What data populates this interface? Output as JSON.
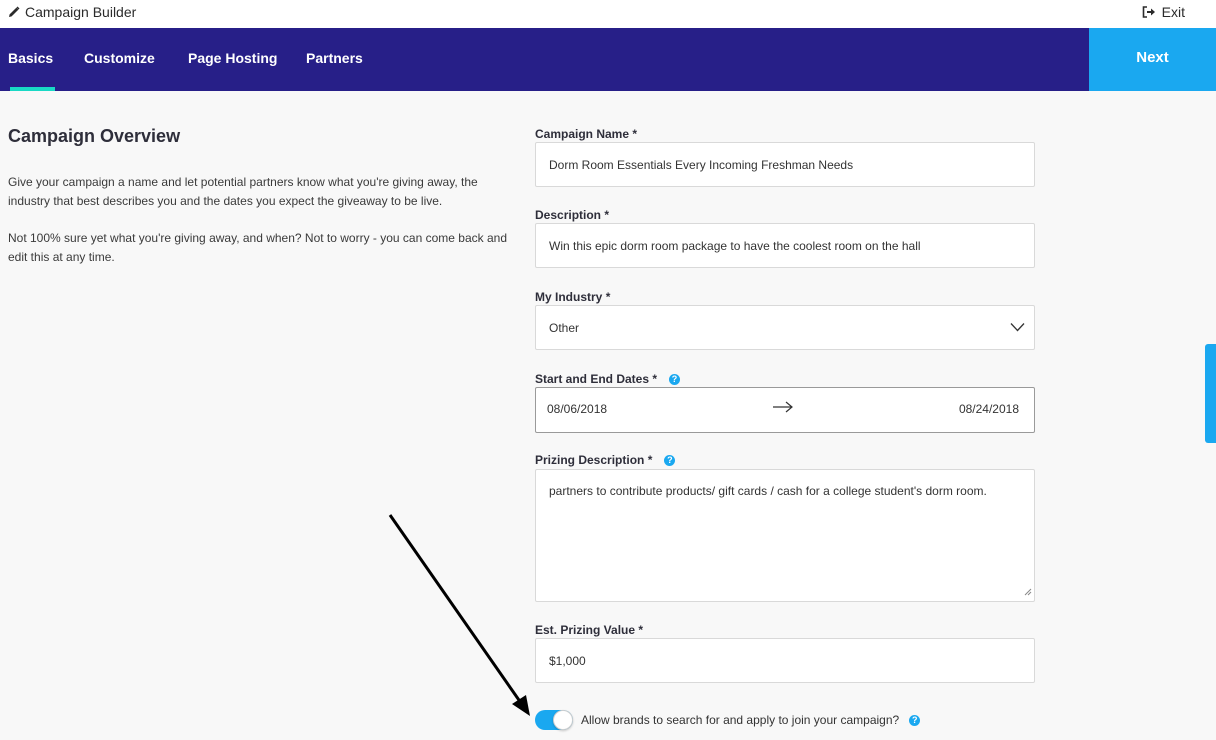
{
  "header": {
    "title": "Campaign Builder",
    "exit_label": "Exit"
  },
  "nav": {
    "tabs": [
      {
        "label": "Basics"
      },
      {
        "label": "Customize"
      },
      {
        "label": "Page Hosting"
      },
      {
        "label": "Partners"
      }
    ],
    "active_tab": "Basics",
    "next_label": "Next"
  },
  "overview": {
    "title": "Campaign Overview",
    "paragraph1_line1": "Give your campaign a name and let potential partners know what you're giving away, the",
    "paragraph1_line2": "industry that best describes you and the dates you expect the giveaway to be live.",
    "paragraph2_line1": "Not 100% sure yet what you're giving away, and when? Not to worry - you can come back and",
    "paragraph2_line2": "edit this at any time."
  },
  "form": {
    "required_mark": "*",
    "campaign_name": {
      "label": "Campaign Name",
      "value": "Dorm Room Essentials Every Incoming Freshman Needs"
    },
    "description": {
      "label": "Description",
      "value": "Win this epic dorm room package to have the coolest room on the hall"
    },
    "industry": {
      "label": "My Industry",
      "value": "Other"
    },
    "dates": {
      "label": "Start and End Dates",
      "start": "08/06/2018",
      "end": "08/24/2018"
    },
    "prizing_description": {
      "label": "Prizing Description",
      "value": "partners to contribute products/ gift cards / cash for a college student's dorm room."
    },
    "prizing_value": {
      "label": "Est. Prizing Value",
      "value": "$1,000"
    },
    "allow_brands": {
      "label": "Allow brands to search for and apply to join your campaign?",
      "enabled": true
    }
  },
  "help_icon_glyph": "?",
  "colors": {
    "nav_bg": "#271f88",
    "accent": "#1aa8f0",
    "tab_underline": "#19d9c5"
  }
}
